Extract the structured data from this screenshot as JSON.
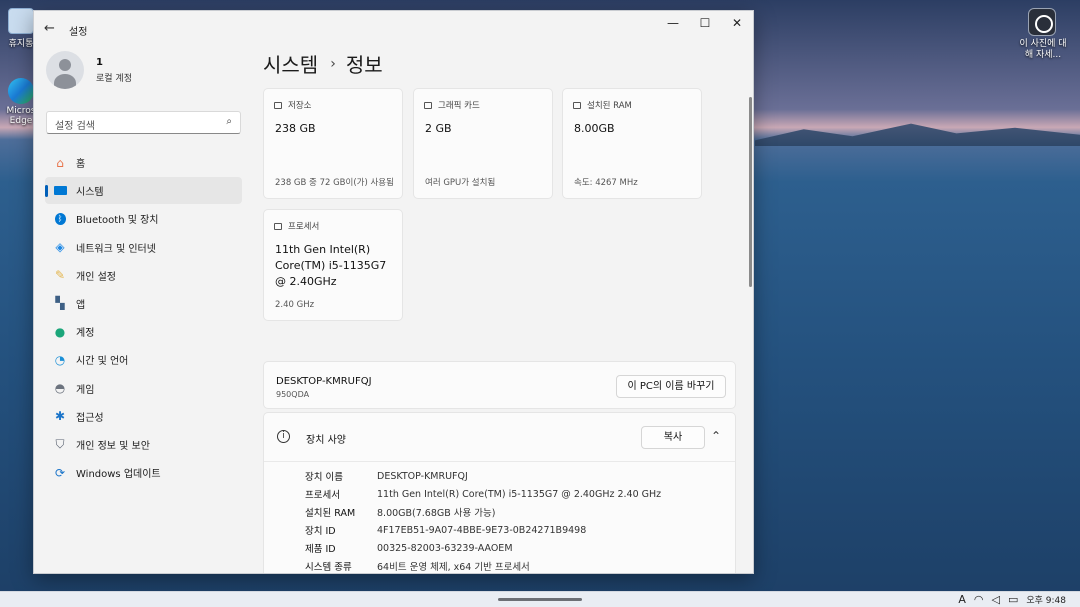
{
  "desktop": {
    "left_icons": [
      "휴지통",
      "Micros Edge"
    ],
    "right_icon_label": "이 사진에 대해 자세..."
  },
  "taskbar": {
    "tray_items": [
      "A",
      "wifi",
      "volume",
      "battery"
    ],
    "ime": "A",
    "clock": "오후 9:48"
  },
  "window": {
    "title": "설정",
    "back_glyph": "←",
    "caption_buttons": [
      "—",
      "☐",
      "✕"
    ]
  },
  "profile": {
    "name": "1",
    "account_type": "로컬 계정"
  },
  "search": {
    "placeholder": "설정 검색"
  },
  "nav": {
    "items": [
      {
        "label": "홈",
        "icon": "home-icon",
        "color": "#e8734a"
      },
      {
        "label": "시스템",
        "icon": "system-icon",
        "color": "#0078d4",
        "active": true
      },
      {
        "label": "Bluetooth 및 장치",
        "icon": "bluetooth-icon",
        "color": "#0078d4"
      },
      {
        "label": "네트워크 및 인터넷",
        "icon": "wifi-icon",
        "color": "#1e88e5"
      },
      {
        "label": "개인 설정",
        "icon": "brush-icon",
        "color": "#e3b44a"
      },
      {
        "label": "앱",
        "icon": "apps-icon",
        "color": "#3d5f84"
      },
      {
        "label": "계정",
        "icon": "account-icon",
        "color": "#1ba67a"
      },
      {
        "label": "시간 및 언어",
        "icon": "globe-clock-icon",
        "color": "#1a8fd6"
      },
      {
        "label": "게임",
        "icon": "gamepad-icon",
        "color": "#6c737e"
      },
      {
        "label": "접근성",
        "icon": "accessibility-icon",
        "color": "#1a74c9"
      },
      {
        "label": "개인 정보 및 보안",
        "icon": "shield-icon",
        "color": "#5a6270"
      },
      {
        "label": "Windows 업데이트",
        "icon": "update-icon",
        "color": "#1a74c9"
      }
    ]
  },
  "breadcrumb": {
    "parent": "시스템",
    "separator": "›",
    "current": "정보"
  },
  "cards": {
    "storage": {
      "label": "저장소",
      "value": "238 GB",
      "detail": "238 GB 중 72 GB이(가) 사용됨"
    },
    "graphics": {
      "label": "그래픽 카드",
      "value": "2 GB",
      "detail": "여러 GPU가 설치됨"
    },
    "ram": {
      "label": "설치된 RAM",
      "value": "8.00GB",
      "detail": "속도: 4267 MHz"
    },
    "processor": {
      "label": "프로세서",
      "value": "11th Gen Intel(R) Core(TM) i5-1135G7 @ 2.40GHz",
      "detail": "2.40 GHz"
    }
  },
  "pc": {
    "name": "DESKTOP-KMRUFQJ",
    "model": "950QDA",
    "rename_button": "이 PC의 이름 바꾸기"
  },
  "specs": {
    "title": "장치 사양",
    "copy_button": "복사",
    "rows": [
      {
        "key": "장치 이름",
        "value": "DESKTOP-KMRUFQJ"
      },
      {
        "key": "프로세서",
        "value": "11th Gen Intel(R) Core(TM) i5-1135G7 @ 2.40GHz   2.40 GHz"
      },
      {
        "key": "설치된 RAM",
        "value": "8.00GB(7.68GB 사용 가능)"
      },
      {
        "key": "장치 ID",
        "value": "4F17EB51-9A07-4BBE-9E73-0B24271B9498"
      },
      {
        "key": "제품 ID",
        "value": "00325-82003-63239-AAOEM"
      },
      {
        "key": "시스템 종류",
        "value": "64비트 운영 체제, x64 기반 프로세서"
      }
    ]
  },
  "colors": {
    "accent": "#005fb8",
    "window_bg": "#f3f3f3",
    "card_bg": "#fbfbfb"
  }
}
